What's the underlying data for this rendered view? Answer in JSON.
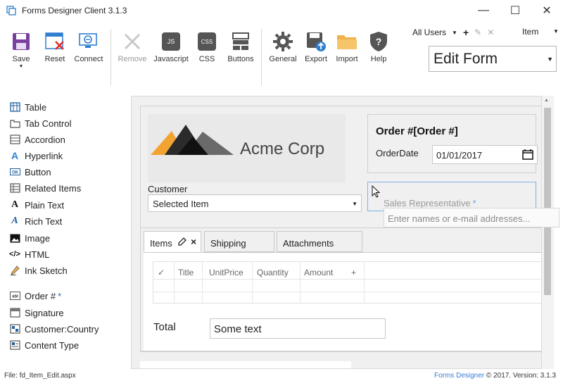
{
  "window": {
    "title": "Forms Designer Client 3.1.3",
    "min_glyph": "—",
    "max_glyph": "☐",
    "close_glyph": "✕"
  },
  "ribbon": {
    "save": "Save",
    "reset": "Reset",
    "connect": "Connect",
    "remove": "Remove",
    "javascript": "Javascript",
    "javascript_badge": "JS",
    "css": "CSS",
    "css_badge": "CSS",
    "buttons": "Buttons",
    "general": "General",
    "export": "Export",
    "import": "Import",
    "help": "Help",
    "groups_selector": "All Users",
    "item_selector": "Item",
    "mode": "Edit Form"
  },
  "palette": {
    "items": [
      {
        "label": "Table",
        "icon": "table-icon"
      },
      {
        "label": "Tab Control",
        "icon": "tab-control-icon"
      },
      {
        "label": "Accordion",
        "icon": "accordion-icon"
      },
      {
        "label": "Hyperlink",
        "icon": "hyperlink-icon"
      },
      {
        "label": "Button",
        "icon": "button-icon"
      },
      {
        "label": "Related Items",
        "icon": "related-items-icon"
      },
      {
        "label": "Plain Text",
        "icon": "plain-text-icon"
      },
      {
        "label": "Rich Text",
        "icon": "rich-text-icon"
      },
      {
        "label": "Image",
        "icon": "image-icon"
      },
      {
        "label": "HTML",
        "icon": "html-icon"
      },
      {
        "label": "Ink Sketch",
        "icon": "ink-sketch-icon"
      }
    ],
    "fields": [
      {
        "label": "Order #",
        "required": "*",
        "icon": "text-field-icon"
      },
      {
        "label": "Signature",
        "icon": "signature-icon"
      },
      {
        "label": "Customer:Country",
        "icon": "lookup-icon"
      },
      {
        "label": "Content Type",
        "icon": "content-type-icon"
      }
    ]
  },
  "form": {
    "logo_text": "Acme Corp",
    "order_title": "Order #[Order #]",
    "order_date_label": "OrderDate",
    "order_date_value": "01/01/2017",
    "customer_label": "Customer",
    "customer_value": "Selected Item",
    "sales_rep_label": "Sales Representative",
    "sales_rep_required": "*",
    "people_picker_placeholder": "Enter names or e-mail addresses...",
    "tabs": [
      {
        "label": "Items"
      },
      {
        "label": "Shipping"
      },
      {
        "label": "Attachments"
      }
    ],
    "grid_headers": [
      "✓",
      "Title",
      "UnitPrice",
      "Quantity",
      "Amount",
      "+"
    ],
    "total_label": "Total",
    "total_value": "Some text"
  },
  "status": {
    "file": "File:  fd_Item_Edit.aspx",
    "brand": "Forms Designer",
    "copyright": " © 2017. Version: 3.1.3"
  },
  "colors": {
    "accent_purple": "#7b3fa0",
    "logo_orange": "#f3a332",
    "logo_dark": "#3a3a3a",
    "focus_blue": "#7fb2e0"
  }
}
